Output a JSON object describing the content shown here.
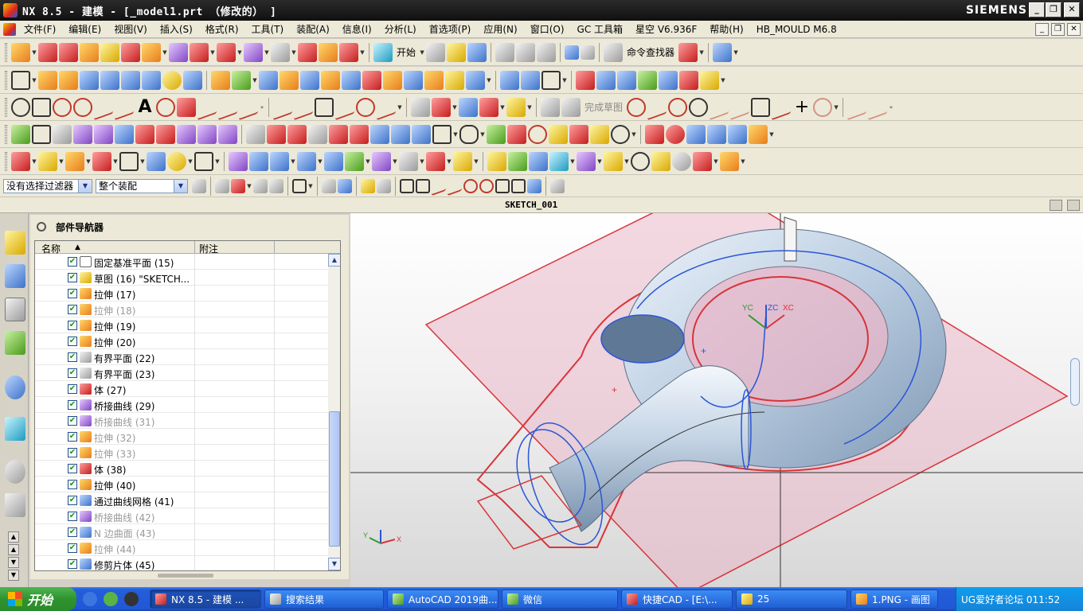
{
  "window": {
    "title": "NX 8.5 - 建模 - [_model1.prt （修改的） ]",
    "brand": "SIEMENS",
    "controls": [
      "_",
      "❐",
      "✕"
    ]
  },
  "menu": {
    "items": [
      "文件(F)",
      "编辑(E)",
      "视图(V)",
      "插入(S)",
      "格式(R)",
      "工具(T)",
      "装配(A)",
      "信息(I)",
      "分析(L)",
      "首选项(P)",
      "应用(N)",
      "窗口(O)",
      "GC 工具箱",
      "星空 V6.936F",
      "帮助(H)",
      "HB_MOULD M6.8"
    ]
  },
  "toolbar": {
    "start_label": "开始",
    "command_finder_label": "命令查找器",
    "finish_sketch_label": "完成草图"
  },
  "filter": {
    "selection_filter": "没有选择过滤器",
    "assembly_scope": "整个装配"
  },
  "sketch": {
    "name": "SKETCH_001"
  },
  "navigator": {
    "title": "部件导航器",
    "col_name": "名称",
    "col_note": "附注",
    "rows": [
      {
        "label": "固定基准平面 (15)",
        "icon": "datum-plane-icon",
        "dim": false
      },
      {
        "label": "草图 (16) \"SKETCH...",
        "icon": "sketch-icon",
        "dim": false
      },
      {
        "label": "拉伸 (17)",
        "icon": "extrude-icon",
        "dim": false
      },
      {
        "label": "拉伸 (18)",
        "icon": "extrude-icon",
        "dim": true
      },
      {
        "label": "拉伸 (19)",
        "icon": "extrude-icon",
        "dim": false
      },
      {
        "label": "拉伸 (20)",
        "icon": "extrude-icon",
        "dim": false
      },
      {
        "label": "有界平面 (22)",
        "icon": "bounded-plane-icon",
        "dim": false
      },
      {
        "label": "有界平面 (23)",
        "icon": "bounded-plane-icon",
        "dim": false
      },
      {
        "label": "体 (27)",
        "icon": "body-icon",
        "dim": false
      },
      {
        "label": "桥接曲线 (29)",
        "icon": "bridge-curve-icon",
        "dim": false
      },
      {
        "label": "桥接曲线 (31)",
        "icon": "bridge-curve-icon",
        "dim": true
      },
      {
        "label": "拉伸 (32)",
        "icon": "extrude-icon",
        "dim": true
      },
      {
        "label": "拉伸 (33)",
        "icon": "extrude-icon",
        "dim": true
      },
      {
        "label": "体 (38)",
        "icon": "body-icon",
        "dim": false
      },
      {
        "label": "拉伸 (40)",
        "icon": "extrude-icon",
        "dim": false
      },
      {
        "label": "通过曲线网格 (41)",
        "icon": "curve-mesh-icon",
        "dim": false
      },
      {
        "label": "桥接曲线 (42)",
        "icon": "bridge-curve-icon",
        "dim": true
      },
      {
        "label": "N 边曲面 (43)",
        "icon": "n-sided-surface-icon",
        "dim": true
      },
      {
        "label": "拉伸 (44)",
        "icon": "extrude-icon",
        "dim": true
      },
      {
        "label": "修剪片体 (45)",
        "icon": "trim-sheet-icon",
        "dim": false
      }
    ]
  },
  "viewport": {
    "axis_labels": {
      "yc": "YC",
      "zc": "ZC",
      "xc": "XC"
    },
    "triad_labels": {
      "y": "Y",
      "x": "X"
    }
  },
  "taskbar": {
    "start": "开始",
    "tasks": [
      "NX 8.5 - 建模 ...",
      "搜索结果",
      "AutoCAD 2019曲...",
      "微信",
      "快捷CAD - [E:\\...",
      "25",
      "1.PNG - 画图"
    ],
    "tray_text": "UG爱好者论坛 011:52"
  },
  "colors": {
    "titlebar": "#1a1a1a",
    "accent_blue": "#245edb",
    "sketch_red": "#d9343a",
    "plane_pink": "#e9b7c8",
    "curve_blue": "#2a55d8"
  }
}
